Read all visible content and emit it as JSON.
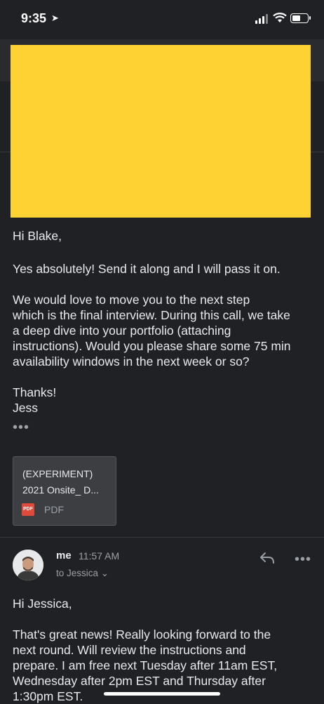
{
  "status_bar": {
    "time": "9:35",
    "battery_level": 0.55
  },
  "email_top": {
    "greeting": "Hi Blake,",
    "paragraph1": "Yes absolutely! Send it along and I will pass it on.",
    "paragraph2": "We would love to move you to the next step\nwhich is the final interview. During this call, we take\na deep dive into your portfolio (attaching\ninstructions). Would you please share some 75 min\navailability windows in the next week or so?",
    "signoff": "Thanks!\nJess",
    "more_glyph": "•••"
  },
  "attachment": {
    "title_line1": "(EXPERIMENT)",
    "title_line2": "2021 Onsite_ D...",
    "icon_text": "PDF",
    "type_label": "PDF"
  },
  "reply_message": {
    "sender": "me",
    "time": "11:57 AM",
    "recipient": "to Jessica",
    "greeting": "Hi Jessica,",
    "body": "That's great news! Really looking forward to the\nnext round. Will review the instructions and\nprepare. I am free next Tuesday after 11am EST,\nWednesday after 2pm EST and Thursday after\n1:30pm EST."
  },
  "colors": {
    "background": "#202124",
    "preview_yellow": "#ffd234",
    "text": "#e8eaed",
    "muted": "#9aa0a6"
  }
}
